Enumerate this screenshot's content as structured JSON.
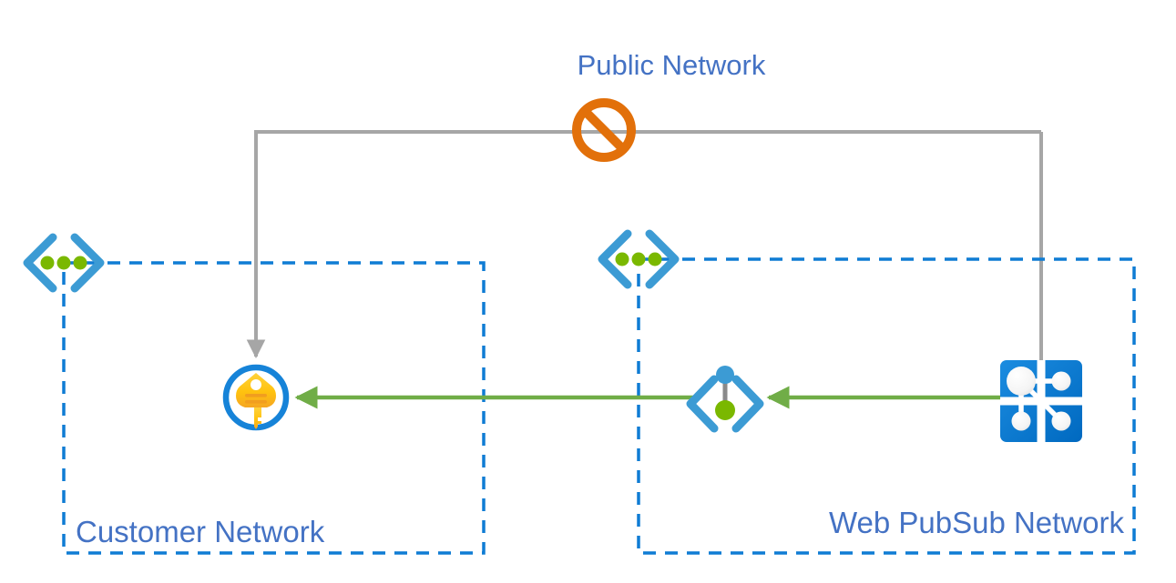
{
  "diagram": {
    "title": "Public Network",
    "background_color": "#ffffff",
    "label_color": "#4472C4",
    "blocked_icon_color": "#E2700A",
    "public_line_color": "#A6A6A6",
    "private_line_color": "#70AD47",
    "boundary_color": "#0F7CD4",
    "azure_blue": "#0F7CD4",
    "key_gold": "#FFC20E",
    "vnet_dot_green": "#7AB800"
  },
  "zones": [
    {
      "id": "customer-network",
      "label": "Customer Network",
      "boundary_style": "dashed",
      "boundary_color": "#0F7CD4"
    },
    {
      "id": "web-pubsub-network",
      "label": "Web PubSub Network",
      "boundary_style": "dashed",
      "boundary_color": "#0F7CD4"
    }
  ],
  "nodes": [
    {
      "id": "blocked-public-access",
      "icon": "no-entry-icon",
      "label": "",
      "color": "#E2700A",
      "zone": "public"
    },
    {
      "id": "customer-vnet-marker",
      "icon": "virtual-network-icon",
      "label": "",
      "zone": "customer-network"
    },
    {
      "id": "web-pubsub-vnet-marker",
      "icon": "virtual-network-icon",
      "label": "",
      "zone": "web-pubsub-network"
    },
    {
      "id": "key-vault",
      "icon": "key-icon",
      "label": "",
      "zone": "customer-network"
    },
    {
      "id": "private-endpoint",
      "icon": "private-endpoint-icon",
      "label": "",
      "zone": "web-pubsub-network"
    },
    {
      "id": "web-pubsub-service",
      "icon": "web-pubsub-icon",
      "label": "",
      "zone": "web-pubsub-network"
    }
  ],
  "connections": [
    {
      "id": "public-network-path",
      "from": "web-pubsub-service",
      "to": "key-vault",
      "style": "solid",
      "color": "#A6A6A6",
      "arrow": "end",
      "blocked": true,
      "label": "Public Network"
    },
    {
      "id": "private-link-pubsub-to-endpoint",
      "from": "web-pubsub-service",
      "to": "private-endpoint",
      "style": "solid",
      "color": "#70AD47",
      "arrow": "end",
      "blocked": false
    },
    {
      "id": "private-link-endpoint-to-keyvault",
      "from": "private-endpoint",
      "to": "key-vault",
      "style": "solid",
      "color": "#70AD47",
      "arrow": "end",
      "blocked": false
    }
  ]
}
